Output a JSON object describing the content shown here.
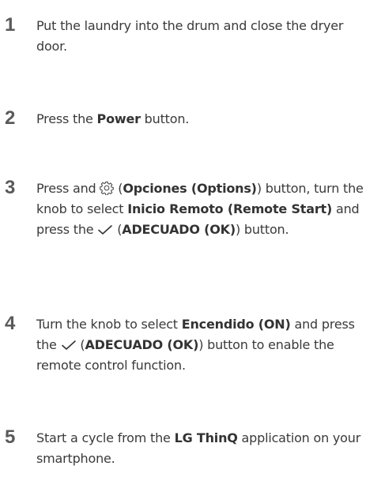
{
  "steps": [
    {
      "number": "1",
      "text": "Put the laundry into the drum and close the dryer door."
    },
    {
      "number": "2",
      "before": "Press the ",
      "bold": "Power",
      "after": " button."
    },
    {
      "number": "3",
      "t1": "Press and ",
      "icon": "gear-icon",
      "t2": " (",
      "b1": "Opciones (Options)",
      "t3": ") button, turn the knob to select ",
      "b2": "Inicio Remoto (Remote Start)",
      "t4": " and press the ",
      "icon2": "checkmark-icon",
      "t5": " (",
      "b3": "ADECUADO (OK)",
      "t6": ") button."
    },
    {
      "number": "4",
      "t1": "Turn the knob to select ",
      "b1": "Encendido (ON)",
      "t2": " and press the ",
      "icon": "checkmark-icon",
      "t3": " (",
      "b2": "ADECUADO (OK)",
      "t4": ") button to enable the remote control function."
    },
    {
      "number": "5",
      "t1": "Start a cycle from the ",
      "b1": "LG ThinQ",
      "t2": " application on your smartphone."
    }
  ]
}
